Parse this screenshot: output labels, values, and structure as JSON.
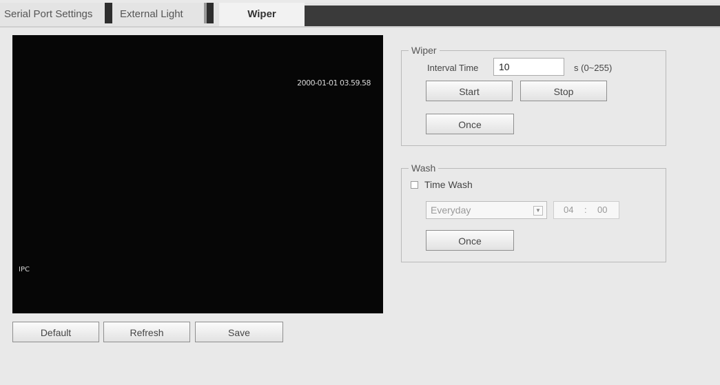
{
  "tabs": [
    {
      "label": "Serial Port Settings"
    },
    {
      "label": "External Light"
    },
    {
      "label": "Wiper"
    }
  ],
  "video": {
    "timestamp": "2000-01-01 03.59.58",
    "camera_label": "IPC"
  },
  "bottom_buttons": {
    "default_label": "Default",
    "refresh_label": "Refresh",
    "save_label": "Save"
  },
  "wiper": {
    "legend": "Wiper",
    "interval_label": "Interval Time",
    "interval_value": "10",
    "interval_unit": "s (0~255)",
    "start_label": "Start",
    "stop_label": "Stop",
    "once_label": "Once"
  },
  "wash": {
    "legend": "Wash",
    "time_wash_label": "Time Wash",
    "time_wash_checked": false,
    "schedule_value": "Everyday",
    "hour": "04",
    "colon": ":",
    "minute": "00",
    "once_label": "Once"
  }
}
